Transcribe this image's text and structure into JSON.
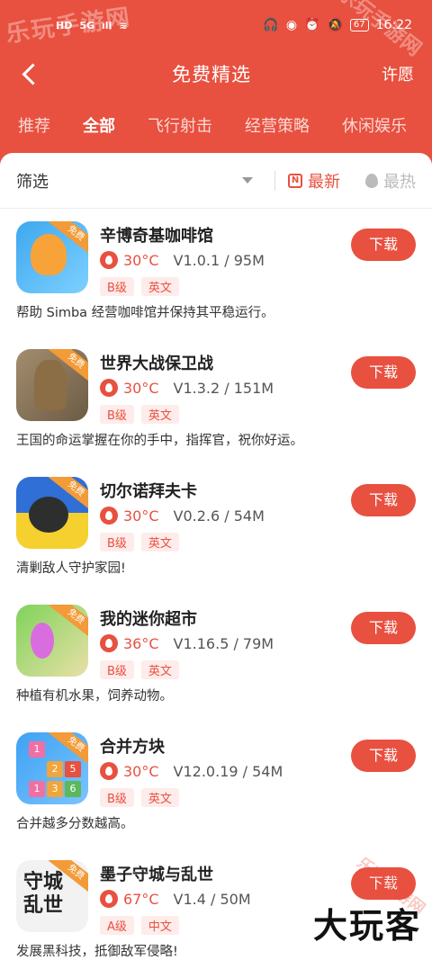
{
  "status_bar": {
    "left": [
      "HD",
      "5G",
      "ıll",
      "≋"
    ],
    "right_icons": [
      "headphones-icon",
      "eye-icon",
      "alarm-icon",
      "mute-icon"
    ],
    "battery": "67",
    "time": "16:22"
  },
  "watermarks": {
    "top_left": "乐玩手游网",
    "top_right": "乐玩手游网",
    "bottom": "大玩客"
  },
  "navbar": {
    "title": "免费精选",
    "action": "许愿"
  },
  "tabs": [
    "推荐",
    "全部",
    "飞行射击",
    "经营策略",
    "休闲娱乐"
  ],
  "active_tab": 1,
  "filter": {
    "label": "筛选",
    "sort_new": "最新",
    "sort_hot": "最热"
  },
  "free_badge": "免费",
  "download_label": "下载",
  "games": [
    {
      "name": "辛博奇基咖啡馆",
      "temp": "30°C",
      "version": "V1.0.1 / 95M",
      "tags": [
        "B级",
        "英文"
      ],
      "desc": "帮助 Simba 经营咖啡馆并保持其平稳运行。"
    },
    {
      "name": "世界大战保卫战",
      "temp": "30°C",
      "version": "V1.3.2 / 151M",
      "tags": [
        "B级",
        "英文"
      ],
      "desc": "王国的命运掌握在你的手中，指挥官，祝你好运。"
    },
    {
      "name": "切尔诺拜夫卡",
      "temp": "30°C",
      "version": "V0.2.6 / 54M",
      "tags": [
        "B级",
        "英文"
      ],
      "desc": "清剿敌人守护家园!"
    },
    {
      "name": "我的迷你超市",
      "temp": "36°C",
      "version": "V1.16.5 / 79M",
      "tags": [
        "B级",
        "英文"
      ],
      "desc": "种植有机水果，饲养动物。"
    },
    {
      "name": "合并方块",
      "temp": "30°C",
      "version": "V12.0.19 / 54M",
      "tags": [
        "B级",
        "英文"
      ],
      "desc": "合并越多分数越高。"
    },
    {
      "name": "墨子守城与乱世",
      "temp": "67°C",
      "version": "V1.4 / 50M",
      "tags": [
        "A级",
        "中文"
      ],
      "desc": "发展黑科技，抵御敌军侵略!"
    }
  ],
  "icon_texts": {
    "merge_cells": [
      "1",
      "2",
      "5",
      "1",
      "3",
      "6"
    ],
    "ink_text": "守城 乱世"
  },
  "colors": {
    "accent": "#e8503f",
    "badge": "#f29b38"
  }
}
